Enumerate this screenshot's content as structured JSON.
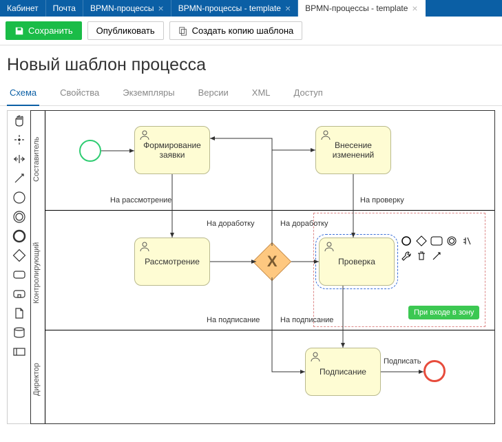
{
  "nav": {
    "items": [
      {
        "label": "Кабинет",
        "closable": false,
        "active": false
      },
      {
        "label": "Почта",
        "closable": false,
        "active": false
      },
      {
        "label": "BPMN-процессы",
        "closable": true,
        "active": false
      },
      {
        "label": "BPMN-процессы - template",
        "closable": true,
        "active": false
      },
      {
        "label": "BPMN-процессы - template",
        "closable": true,
        "active": true
      }
    ]
  },
  "toolbar": {
    "save_label": "Сохранить",
    "publish_label": "Опубликовать",
    "copy_label": "Создать копию шаблона"
  },
  "page_title": "Новый шаблон процесса",
  "tabs": [
    {
      "label": "Схема",
      "active": true
    },
    {
      "label": "Свойства",
      "active": false
    },
    {
      "label": "Экземпляры",
      "active": false
    },
    {
      "label": "Версии",
      "active": false
    },
    {
      "label": "XML",
      "active": false
    },
    {
      "label": "Доступ",
      "active": false
    }
  ],
  "diagram": {
    "lanes": [
      {
        "name": "Составитель"
      },
      {
        "name": "Контролирующий"
      },
      {
        "name": "Директор"
      }
    ],
    "tasks": {
      "form_request": "Формирование заявки",
      "make_changes": "Внесение изменений",
      "review": "Рассмотрение",
      "check": "Проверка",
      "sign": "Подписание"
    },
    "flows": {
      "to_review": "На рассмотрение",
      "to_rework1": "На доработку",
      "to_rework2": "На доработку",
      "to_check": "На проверку",
      "to_sign1": "На подписание",
      "to_sign2": "На подписание",
      "sign_action": "Подписать"
    },
    "zone_badge": "При входе в зону",
    "context_tools": [
      "circle-icon",
      "diamond-icon",
      "rounded-rect-icon",
      "ring-icon",
      "connect-icon",
      "wrench-icon",
      "trash-icon",
      "arrow-icon"
    ]
  },
  "palette": [
    "hand-tool",
    "lasso-tool",
    "space-tool",
    "connect-tool",
    "start-event",
    "intermediate-event",
    "end-event",
    "gateway",
    "task",
    "subprocess",
    "data-object",
    "data-store",
    "participant"
  ]
}
